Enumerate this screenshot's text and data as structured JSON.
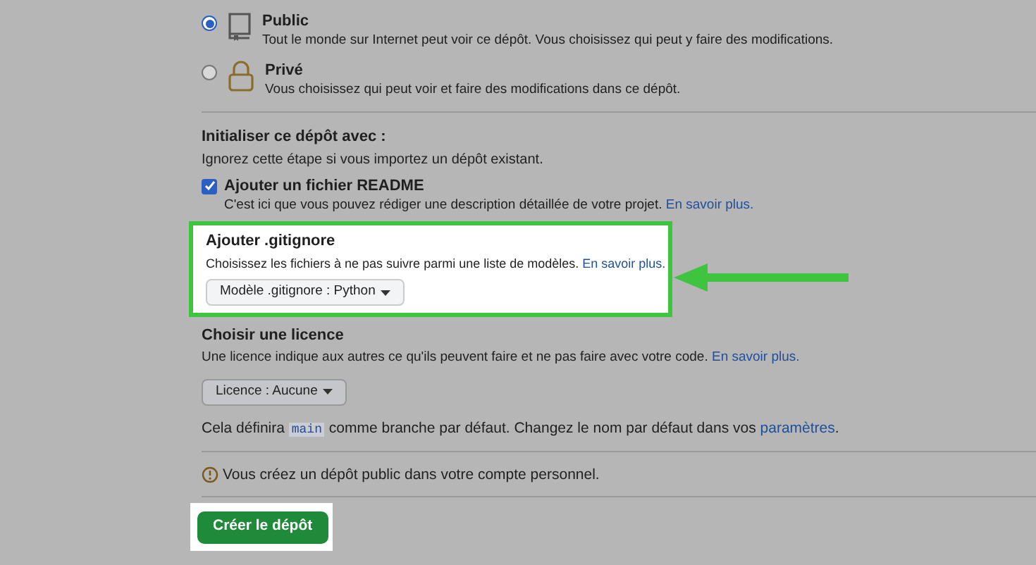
{
  "visibility": [
    {
      "kind": "public",
      "title": "Public",
      "description": "Tout le monde sur Internet peut voir ce dépôt. Vous choisissez qui peut y faire des modifications.",
      "selected": true
    },
    {
      "kind": "private",
      "title": "Privé",
      "description": "Vous choisissez qui peut voir et faire des modifications dans ce dépôt.",
      "selected": false
    }
  ],
  "initialize": {
    "title": "Initialiser ce dépôt avec :",
    "description": "Ignorez cette étape si vous importez un dépôt existant.",
    "readme": {
      "label": "Ajouter un fichier README",
      "checked": true,
      "description": "C'est ici que vous pouvez rédiger une description détaillée de votre projet.",
      "link": "En savoir plus."
    }
  },
  "gitignore": {
    "title": "Ajouter .gitignore",
    "description": "Choisissez les fichiers à ne pas suivre parmi une liste de modèles.",
    "link": "En savoir plus.",
    "dropdown": "Modèle .gitignore : Python",
    "highlighted": true
  },
  "license": {
    "title": "Choisir une licence",
    "description": "Une licence indique aux autres ce qu'ils peuvent faire et ne pas faire avec votre code.",
    "link": "En savoir plus.",
    "dropdown": "Licence : Aucune"
  },
  "branch_note": {
    "before": "Cela définira",
    "code": "main",
    "after": "comme branche par défaut. Changez le nom par défaut dans vos",
    "link": "paramètres",
    "end": "."
  },
  "warning": "Vous créez un dépôt public dans votre compte personnel.",
  "create_button": {
    "label": "Créer le dépôt",
    "highlighted": true
  }
}
